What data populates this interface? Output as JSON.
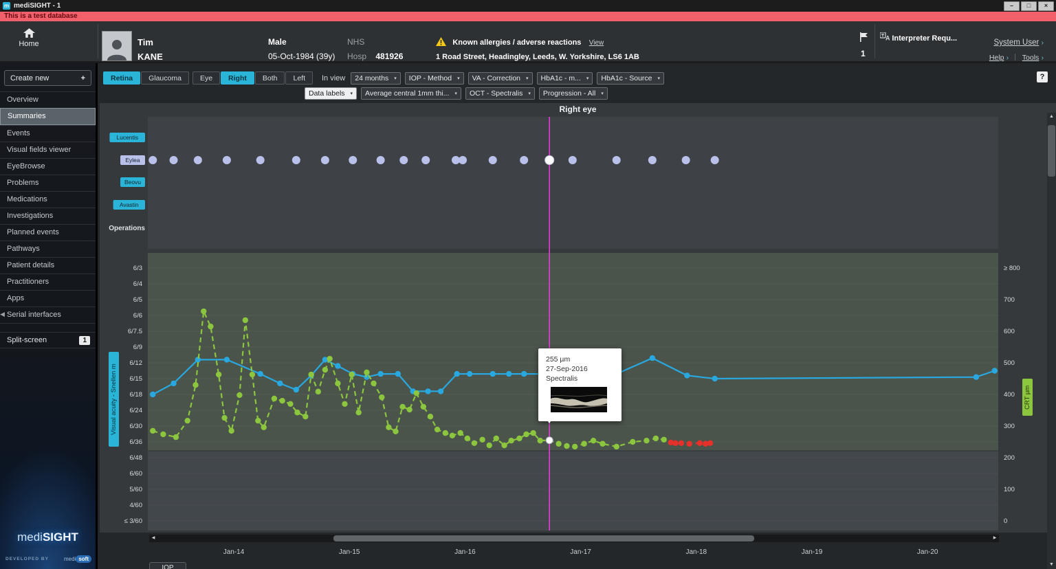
{
  "window": {
    "app_icon": "m",
    "title": "mediSIGHT - 1",
    "banner": "This is a test database",
    "controls": {
      "minimize": "–",
      "maximize": "□",
      "close": "×"
    }
  },
  "icons": {
    "dropdown": "▾",
    "scroll_up": "▲",
    "scroll_down": "▼",
    "scroll_left": "◀",
    "scroll_right": "▶",
    "collapse_left": "◀"
  },
  "header": {
    "home_label": "Home",
    "patient": {
      "first_name": "Tim",
      "last_name": "KANE",
      "sex": "Male",
      "dob": "05-Oct-1984 (39y)",
      "nhs_label": "NHS",
      "hosp_label": "Hosp",
      "hosp_number": "481926",
      "allergies_text": "Known allergies / adverse reactions",
      "view_link": "View",
      "address": "1 Road Street, Headingley, Leeds, W. Yorkshire, LS6 1AB"
    },
    "flag_count": "1",
    "interpreter_label": "Interpreter Requ...",
    "system_user_label": "System User",
    "help_label": "Help",
    "tools_label": "Tools"
  },
  "sidebar": {
    "create_new_label": "Create new",
    "create_new_plus": "+",
    "items": [
      {
        "label": "Overview"
      },
      {
        "label": "Summaries",
        "selected": true
      },
      {
        "label": "Events"
      },
      {
        "label": "Visual fields viewer"
      },
      {
        "label": "EyeBrowse"
      },
      {
        "label": "Problems"
      },
      {
        "label": "Medications"
      },
      {
        "label": "Investigations"
      },
      {
        "label": "Planned events"
      },
      {
        "label": "Pathways"
      },
      {
        "label": "Patient details"
      },
      {
        "label": "Practitioners"
      },
      {
        "label": "Apps"
      },
      {
        "label": "Serial interfaces"
      }
    ],
    "split_screen_label": "Split-screen",
    "split_screen_count": "1",
    "logo_medi": "medi",
    "logo_sight": "SIGHT",
    "developed_by": "DEVELOPED BY",
    "developer_medi": "medi",
    "developer_soft": "soft"
  },
  "toolbar": {
    "view_tabs": [
      {
        "label": "Retina",
        "selected": true
      },
      {
        "label": "Glaucoma",
        "selected": false
      }
    ],
    "eye_buttons": [
      {
        "label": "Eye",
        "selected": false
      },
      {
        "label": "Right",
        "selected": true
      },
      {
        "label": "Both",
        "selected": false
      },
      {
        "label": "Left",
        "selected": false
      }
    ],
    "in_view_label": "In view",
    "row1_selects": [
      {
        "value": "24 months"
      },
      {
        "value": "IOP - Method"
      },
      {
        "value": "VA - Correction"
      },
      {
        "value": "HbA1c - m..."
      },
      {
        "value": "HbA1c - Source"
      }
    ],
    "row2_selects": [
      {
        "value": "Data labels",
        "light": true
      },
      {
        "value": "Average central 1mm thi..."
      },
      {
        "value": "OCT - Spectralis"
      },
      {
        "value": "Progression - All"
      }
    ],
    "help_button": "?"
  },
  "bottom_tab": "IOP",
  "chart_data": {
    "type": "line",
    "title": "Right eye",
    "colors": {
      "va_line": "#29a8e0",
      "crt_line": "#8cc63e",
      "flagged": "#e8302a",
      "injection_dot": "#b9c0ea",
      "cursor": "#ef3be0",
      "accent": "#2ab5d8"
    },
    "x_axis": {
      "ticks": [
        {
          "label": "Jan-14",
          "t": 2014
        },
        {
          "label": "Jan-15",
          "t": 2015
        },
        {
          "label": "Jan-16",
          "t": 2016
        },
        {
          "label": "Jan-17",
          "t": 2017
        },
        {
          "label": "Jan-18",
          "t": 2018
        },
        {
          "label": "Jan-19",
          "t": 2019
        },
        {
          "label": "Jan-20",
          "t": 2020
        }
      ]
    },
    "va_axis": {
      "label": "Visual acuity - Snellen m",
      "ticks": [
        "6/3",
        "6/4",
        "6/5",
        "6/6",
        "6/7.5",
        "6/9",
        "6/12",
        "6/15",
        "6/18",
        "6/24",
        "6/30",
        "6/36",
        "6/48",
        "6/60",
        "5/60",
        "4/60",
        "≤ 3/60"
      ]
    },
    "crt_axis": {
      "label": "CRT µm",
      "ticks": [
        {
          "label": "≥ 800",
          "v": 800
        },
        {
          "label": "700",
          "v": 700
        },
        {
          "label": "600",
          "v": 600
        },
        {
          "label": "500",
          "v": 500
        },
        {
          "label": "400",
          "v": 400
        },
        {
          "label": "300",
          "v": 300
        },
        {
          "label": "200",
          "v": 200
        },
        {
          "label": "100",
          "v": 100
        },
        {
          "label": "0",
          "v": 0
        }
      ]
    },
    "lanes": [
      {
        "label": "Lucentis",
        "chip_color": "#2ab5d8"
      },
      {
        "label": "Eylea",
        "chip_color": "#b9c0ea"
      },
      {
        "label": "Beovu",
        "chip_color": "#2ab5d8"
      },
      {
        "label": "Avastin",
        "chip_color": "#2ab5d8"
      },
      {
        "label": "Operations",
        "chip_color": ""
      }
    ],
    "injections": {
      "drug": "Eylea",
      "t": [
        2013.3,
        2013.48,
        2013.69,
        2013.94,
        2014.23,
        2014.54,
        2014.79,
        2015.03,
        2015.27,
        2015.47,
        2015.66,
        2015.92,
        2015.98,
        2016.24,
        2016.51,
        2016.73,
        2016.93,
        2017.31,
        2017.62,
        2017.91,
        2018.16
      ],
      "selected_t": 2016.73
    },
    "series": [
      {
        "name": "Visual acuity",
        "axis": "va",
        "dash": false,
        "color": "#29a8e0",
        "points": [
          [
            2013.3,
            8.0
          ],
          [
            2013.48,
            7.3
          ],
          [
            2013.69,
            5.8
          ],
          [
            2013.94,
            5.8
          ],
          [
            2014.23,
            6.7
          ],
          [
            2014.4,
            7.3
          ],
          [
            2014.54,
            7.7
          ],
          [
            2014.67,
            6.8
          ],
          [
            2014.79,
            5.8
          ],
          [
            2014.9,
            6.2
          ],
          [
            2015.03,
            6.7
          ],
          [
            2015.15,
            6.9
          ],
          [
            2015.27,
            6.7
          ],
          [
            2015.42,
            6.7
          ],
          [
            2015.55,
            7.8
          ],
          [
            2015.68,
            7.8
          ],
          [
            2015.79,
            7.8
          ],
          [
            2015.93,
            6.7
          ],
          [
            2016.04,
            6.7
          ],
          [
            2016.24,
            6.7
          ],
          [
            2016.38,
            6.7
          ],
          [
            2016.51,
            6.7
          ],
          [
            2016.73,
            6.7
          ],
          [
            2016.93,
            6.7
          ],
          [
            2017.31,
            6.7
          ],
          [
            2017.62,
            5.7
          ],
          [
            2017.92,
            6.8
          ],
          [
            2018.16,
            7.0
          ],
          [
            2020.42,
            6.9
          ],
          [
            2020.58,
            6.5
          ]
        ]
      },
      {
        "name": "CRT",
        "axis": "crt",
        "dash": true,
        "color": "#8cc63e",
        "points": [
          [
            2013.3,
            285
          ],
          [
            2013.39,
            274
          ],
          [
            2013.5,
            265
          ],
          [
            2013.6,
            317
          ],
          [
            2013.67,
            430
          ],
          [
            2013.74,
            663
          ],
          [
            2013.8,
            615
          ],
          [
            2013.87,
            463
          ],
          [
            2013.92,
            326
          ],
          [
            2013.98,
            285
          ],
          [
            2014.05,
            398
          ],
          [
            2014.1,
            635
          ],
          [
            2014.16,
            463
          ],
          [
            2014.21,
            317
          ],
          [
            2014.26,
            296
          ],
          [
            2014.35,
            387
          ],
          [
            2014.42,
            380
          ],
          [
            2014.49,
            370
          ],
          [
            2014.55,
            343
          ],
          [
            2014.62,
            330
          ],
          [
            2014.67,
            463
          ],
          [
            2014.73,
            409
          ],
          [
            2014.79,
            478
          ],
          [
            2014.83,
            513
          ],
          [
            2014.9,
            435
          ],
          [
            2014.96,
            370
          ],
          [
            2015.02,
            463
          ],
          [
            2015.08,
            343
          ],
          [
            2015.15,
            470
          ],
          [
            2015.21,
            435
          ],
          [
            2015.28,
            391
          ],
          [
            2015.34,
            296
          ],
          [
            2015.4,
            283
          ],
          [
            2015.46,
            361
          ],
          [
            2015.52,
            352
          ],
          [
            2015.58,
            404
          ],
          [
            2015.64,
            361
          ],
          [
            2015.7,
            330
          ],
          [
            2015.76,
            289
          ],
          [
            2015.83,
            278
          ],
          [
            2015.89,
            270
          ],
          [
            2015.96,
            278
          ],
          [
            2016.02,
            261
          ],
          [
            2016.08,
            246
          ],
          [
            2016.15,
            257
          ],
          [
            2016.21,
            239
          ],
          [
            2016.27,
            261
          ],
          [
            2016.34,
            239
          ],
          [
            2016.4,
            254
          ],
          [
            2016.47,
            261
          ],
          [
            2016.53,
            274
          ],
          [
            2016.59,
            278
          ],
          [
            2016.65,
            254
          ],
          [
            2016.73,
            255
          ],
          [
            2016.81,
            244
          ],
          [
            2016.88,
            237
          ],
          [
            2016.95,
            235
          ],
          [
            2017.03,
            244
          ],
          [
            2017.11,
            254
          ],
          [
            2017.19,
            244
          ],
          [
            2017.31,
            235
          ],
          [
            2017.45,
            250
          ],
          [
            2017.57,
            254
          ],
          [
            2017.65,
            261
          ],
          [
            2017.72,
            257
          ]
        ]
      },
      {
        "name": "CRT flagged",
        "axis": "crt",
        "dash": true,
        "dots_only": false,
        "color": "#e8302a",
        "points": [
          [
            2017.78,
            248
          ],
          [
            2017.82,
            246
          ],
          [
            2017.87,
            246
          ],
          [
            2017.94,
            244
          ],
          [
            2018.03,
            246
          ],
          [
            2018.08,
            244
          ],
          [
            2018.12,
            246
          ]
        ]
      }
    ],
    "cursor": {
      "t": 2016.73
    },
    "selected_point": {
      "t": 2016.73,
      "axis": "crt",
      "v": 255
    },
    "tooltip": {
      "line1": "255 µm",
      "line2": "27-Sep-2016",
      "line3": "Spectralis"
    }
  }
}
